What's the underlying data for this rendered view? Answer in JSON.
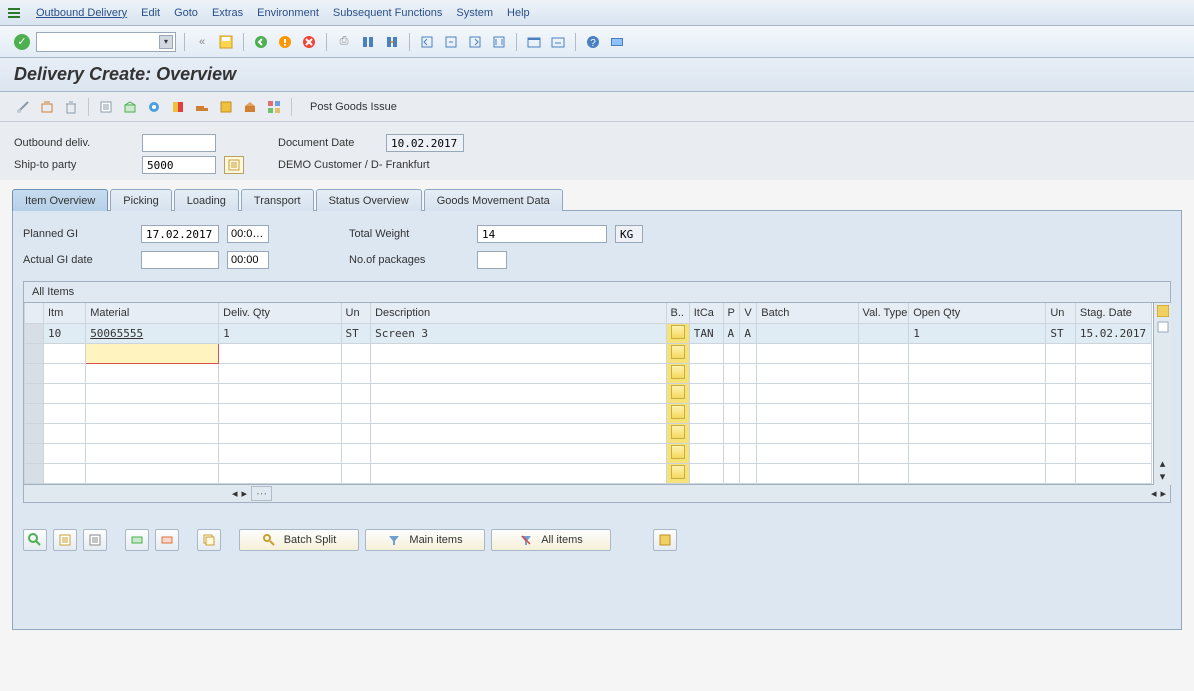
{
  "menu": {
    "items": [
      "Outbound Delivery",
      "Edit",
      "Goto",
      "Extras",
      "Environment",
      "Subsequent Functions",
      "System",
      "Help"
    ]
  },
  "page_title": "Delivery  Create: Overview",
  "app_toolbar": {
    "post_goods_label": "Post Goods Issue"
  },
  "form": {
    "outbound_label": "Outbound deliv.",
    "outbound_value": "",
    "docdate_label": "Document Date",
    "docdate_value": "10.02.2017",
    "shipto_label": "Ship-to party",
    "shipto_value": "5000",
    "shipto_desc": "DEMO Customer / D- Frankfurt"
  },
  "tabs": [
    "Item Overview",
    "Picking",
    "Loading",
    "Transport",
    "Status Overview",
    "Goods Movement Data"
  ],
  "inner": {
    "planned_label": "Planned GI",
    "planned_date": "17.02.2017",
    "planned_time": "00:0…",
    "actual_label": "Actual GI date",
    "actual_date": "",
    "actual_time": "00:00",
    "weight_label": "Total Weight",
    "weight_value": "14",
    "weight_unit": "KG",
    "packages_label": "No.of packages",
    "packages_value": ""
  },
  "table": {
    "title": "All Items",
    "headers": [
      "Itm",
      "Material",
      "Deliv. Qty",
      "Un",
      "Description",
      "B..",
      "ItCa",
      "P",
      "V",
      "Batch",
      "Val. Type",
      "Open Qty",
      "Un",
      "Stag. Date"
    ],
    "rows": [
      {
        "itm": "10",
        "material": "50065555",
        "qty": "1",
        "un": "ST",
        "desc": "Screen 3",
        "b": "",
        "itca": "TAN",
        "p": "A",
        "v": "A",
        "batch": "",
        "val": "",
        "open": "1",
        "un2": "ST",
        "stag": "15.02.2017"
      }
    ]
  },
  "bottom": {
    "batch_split": "Batch Split",
    "main_items": "Main items",
    "all_items": "All items"
  }
}
